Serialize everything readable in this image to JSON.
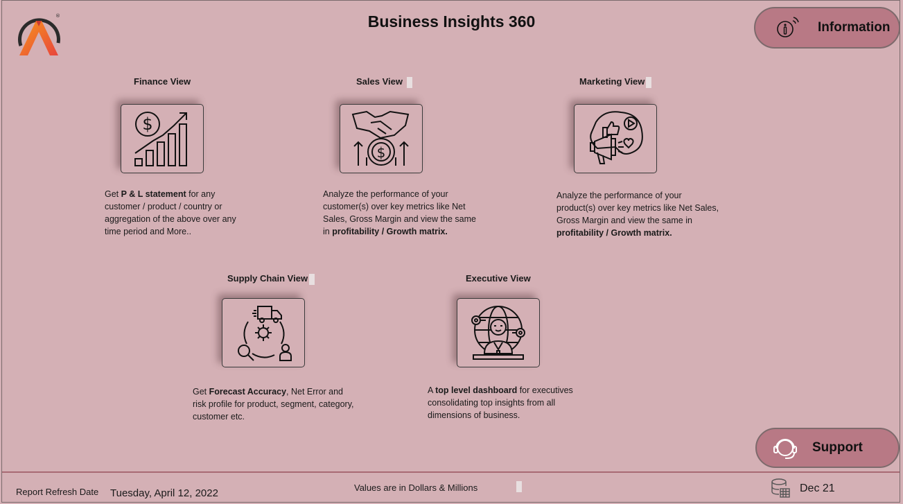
{
  "header": {
    "title": "Business Insights 360",
    "info_label": "Information",
    "support_label": "Support"
  },
  "views": [
    {
      "title": "Finance View",
      "icon": "finance-growth-icon",
      "desc": [
        {
          "t": "Get "
        },
        {
          "t": "P & L statement",
          "b": true
        },
        {
          "t": " for any customer / product / country or aggregation of the above over any time period and More.."
        }
      ]
    },
    {
      "title": "Sales View",
      "icon": "handshake-money-icon",
      "desc": [
        {
          "t": "Analyze the performance of your customer(s) over key metrics like Net Sales, Gross Margin and view the same in "
        },
        {
          "t": "profitability / Growth matrix.",
          "b": true
        }
      ]
    },
    {
      "title": "Marketing View",
      "icon": "megaphone-social-icon",
      "desc": [
        {
          "t": "Analyze the performance of your product(s) over key metrics like Net Sales, Gross Margin and view the same in "
        },
        {
          "t": "profitability / Growth matrix.",
          "b": true
        }
      ]
    },
    {
      "title": "Supply Chain View",
      "icon": "supply-chain-cycle-icon",
      "desc": [
        {
          "t": "Get "
        },
        {
          "t": "Forecast Accuracy",
          "b": true
        },
        {
          "t": ", Net Error and risk profile for product, segment, category, customer etc."
        }
      ]
    },
    {
      "title": "Executive View",
      "icon": "executive-globe-icon",
      "desc": [
        {
          "t": "A "
        },
        {
          "t": "top level dashboard",
          "b": true
        },
        {
          "t": " for executives consolidating top insights from all dimensions of business."
        }
      ]
    }
  ],
  "footer": {
    "refresh_label": "Report Refresh Date",
    "refresh_date": "Tuesday, April 12, 2022",
    "values_note": "Values are in Dollars & Millions",
    "period": "Dec 21"
  },
  "colors": {
    "background": "#d4b0b5",
    "pill": "#b87985",
    "logo_gradient": [
      "#f7941d",
      "#e8453c"
    ]
  }
}
